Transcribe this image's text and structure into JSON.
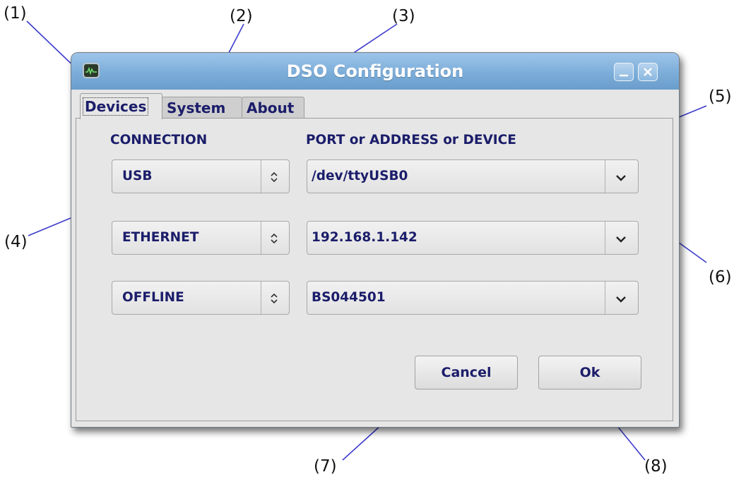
{
  "callouts": [
    "(1)",
    "(2)",
    "(3)",
    "(4)",
    "(5)",
    "(6)",
    "(7)",
    "(8)"
  ],
  "window": {
    "title": "DSO Configuration",
    "icons": {
      "app": "oscilloscope-icon",
      "minimize": "minimize-icon",
      "close": "close-icon"
    }
  },
  "tabs": [
    {
      "label": "Devices",
      "active": true
    },
    {
      "label": "System",
      "active": false
    },
    {
      "label": "About",
      "active": false
    }
  ],
  "devices": {
    "connection_header": "CONNECTION",
    "port_header": "PORT or ADDRESS or DEVICE",
    "rows": [
      {
        "connection": "USB",
        "port": "/dev/ttyUSB0"
      },
      {
        "connection": "ETHERNET",
        "port": "192.168.1.142"
      },
      {
        "connection": "OFFLINE",
        "port": "BS044501"
      }
    ]
  },
  "buttons": {
    "cancel": "Cancel",
    "ok": "Ok"
  },
  "colors": {
    "titlebar": "#7cadd9",
    "label_text": "#1b1d6a",
    "leader_lines": "#3c3ccc",
    "window_bg": "#e6e6e6"
  }
}
